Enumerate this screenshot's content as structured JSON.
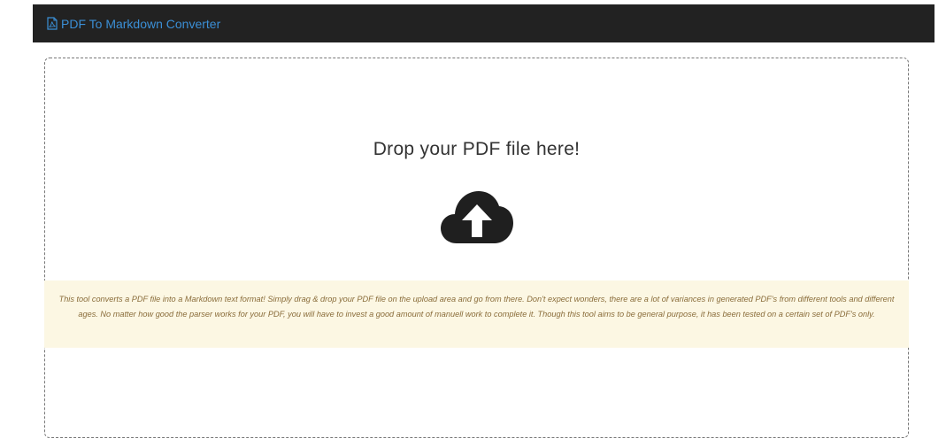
{
  "navbar": {
    "brand_label": "PDF To Markdown Converter",
    "brand_icon": "file-pdf-icon",
    "background_color": "#222222",
    "brand_color": "#3b8fd6"
  },
  "dropzone": {
    "title": "Drop your PDF file here!",
    "upload_icon": "cloud-upload-icon",
    "notice": "This tool converts a PDF file into a Markdown text format! Simply drag & drop your PDF file on the upload area and go from there. Don't expect wonders, there are a lot of variances in generated PDF's from different tools and different ages. No matter how good the parser works for your PDF, you will have to invest a good amount of manuell work to complete it. Though this tool aims to be general purpose, it has been tested on a certain set of PDF's only.",
    "notice_background": "#fcf7e3",
    "notice_text_color": "#8a6d3b"
  }
}
